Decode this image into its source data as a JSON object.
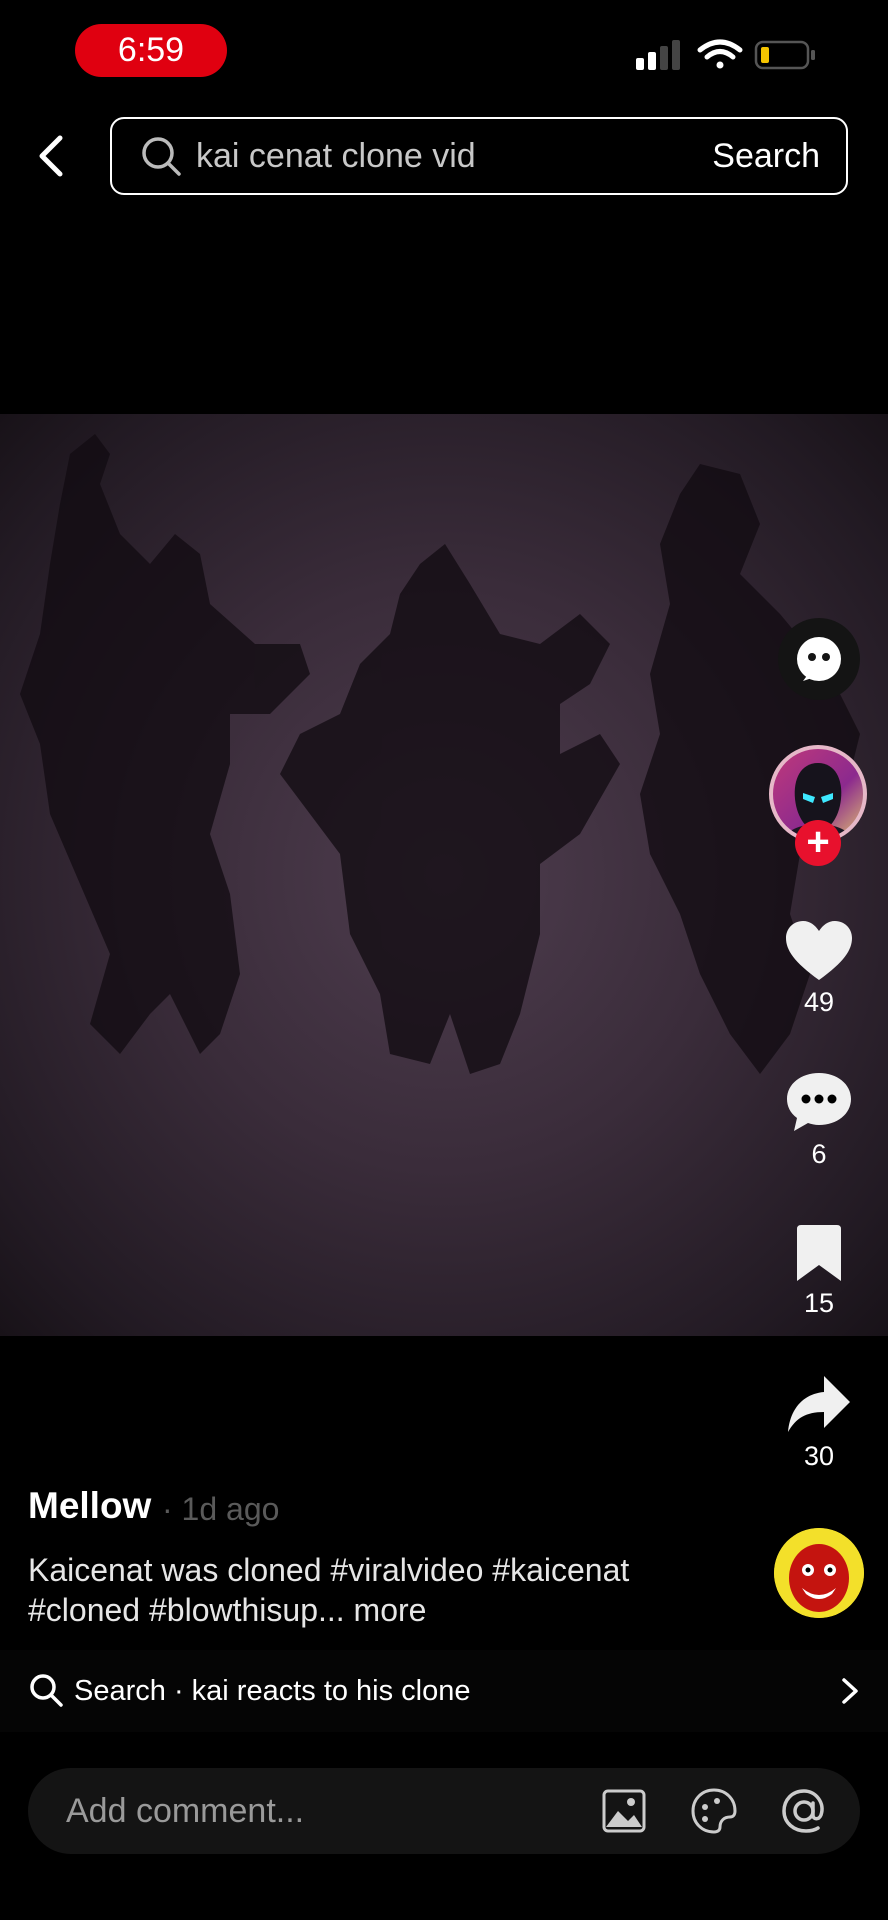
{
  "status_bar": {
    "time": "6:59",
    "signal_icon": "signal-icon",
    "wifi_icon": "wifi-icon",
    "battery_icon": "battery-low-icon",
    "battery_level": 0.15,
    "time_pill_color": "#e00010"
  },
  "header": {
    "back_icon": "chevron-left-icon",
    "search_icon": "search-icon",
    "query": "kai cenat clone vid",
    "search_label": "Search"
  },
  "rail": {
    "ai_icon": "ai-bot-icon",
    "follow_icon": "plus-icon",
    "likes": "49",
    "comments": "6",
    "saves": "15",
    "shares": "30",
    "like_icon": "heart-icon",
    "comment_icon": "comment-bubble-icon",
    "save_icon": "bookmark-icon",
    "share_icon": "share-arrow-icon"
  },
  "post": {
    "username": "Mellow",
    "time_ago": "· 1d ago",
    "caption": "Kaicenat was cloned #viralvideo #kaicenat #cloned #blowthisup...",
    "more_label": "more"
  },
  "suggestion": {
    "text": "Search · kai reacts to his clone"
  },
  "comment": {
    "placeholder": "Add comment...",
    "image_icon": "image-icon",
    "sticker_icon": "sticker-icon",
    "mention_icon": "at-mention-icon"
  },
  "colors": {
    "accent_red": "#e8112d",
    "background": "#000000"
  }
}
